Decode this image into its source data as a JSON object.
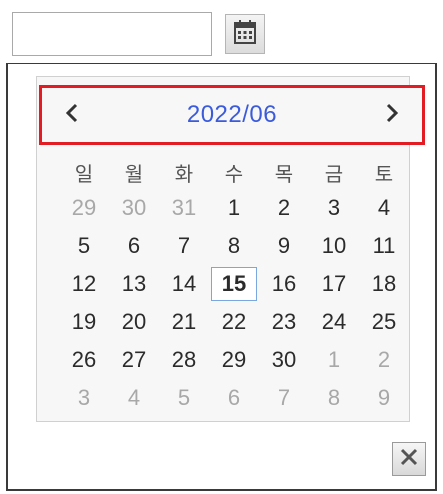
{
  "input": {
    "value": "",
    "placeholder": ""
  },
  "calendar": {
    "title": "2022/06",
    "weekdays": [
      "일",
      "월",
      "화",
      "수",
      "목",
      "금",
      "토"
    ],
    "weeks": [
      [
        {
          "d": "29",
          "o": true
        },
        {
          "d": "30",
          "o": true
        },
        {
          "d": "31",
          "o": true
        },
        {
          "d": "1",
          "o": false
        },
        {
          "d": "2",
          "o": false
        },
        {
          "d": "3",
          "o": false
        },
        {
          "d": "4",
          "o": false
        }
      ],
      [
        {
          "d": "5",
          "o": false
        },
        {
          "d": "6",
          "o": false
        },
        {
          "d": "7",
          "o": false
        },
        {
          "d": "8",
          "o": false
        },
        {
          "d": "9",
          "o": false
        },
        {
          "d": "10",
          "o": false
        },
        {
          "d": "11",
          "o": false
        }
      ],
      [
        {
          "d": "12",
          "o": false
        },
        {
          "d": "13",
          "o": false
        },
        {
          "d": "14",
          "o": false
        },
        {
          "d": "15",
          "o": false,
          "today": true
        },
        {
          "d": "16",
          "o": false
        },
        {
          "d": "17",
          "o": false
        },
        {
          "d": "18",
          "o": false
        }
      ],
      [
        {
          "d": "19",
          "o": false
        },
        {
          "d": "20",
          "o": false
        },
        {
          "d": "21",
          "o": false
        },
        {
          "d": "22",
          "o": false
        },
        {
          "d": "23",
          "o": false
        },
        {
          "d": "24",
          "o": false
        },
        {
          "d": "25",
          "o": false
        }
      ],
      [
        {
          "d": "26",
          "o": false
        },
        {
          "d": "27",
          "o": false
        },
        {
          "d": "28",
          "o": false
        },
        {
          "d": "29",
          "o": false
        },
        {
          "d": "30",
          "o": false
        },
        {
          "d": "1",
          "o": true
        },
        {
          "d": "2",
          "o": true
        }
      ],
      [
        {
          "d": "3",
          "o": true
        },
        {
          "d": "4",
          "o": true
        },
        {
          "d": "5",
          "o": true
        },
        {
          "d": "6",
          "o": true
        },
        {
          "d": "7",
          "o": true
        },
        {
          "d": "8",
          "o": true
        },
        {
          "d": "9",
          "o": true
        }
      ]
    ]
  },
  "icons": {
    "calendar_button": "calendar-icon",
    "prev": "chevron-left-icon",
    "next": "chevron-right-icon",
    "close": "close-icon"
  },
  "colors": {
    "title": "#3b5bdb",
    "highlight_border": "#e31b23",
    "today_border": "#7aa7e0"
  }
}
